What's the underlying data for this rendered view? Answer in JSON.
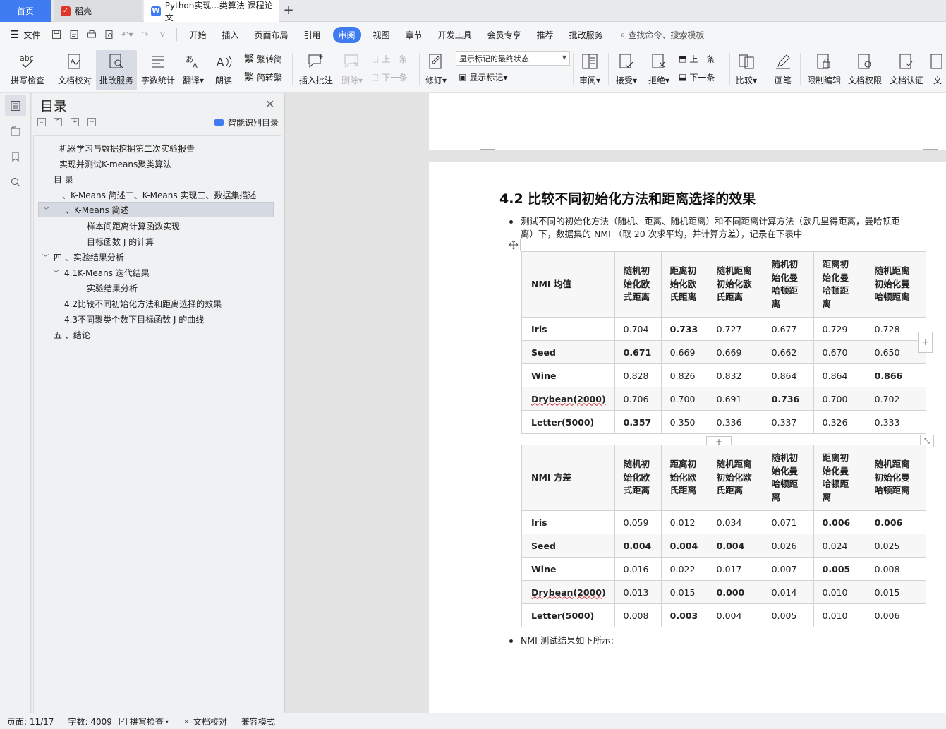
{
  "tabs": {
    "home": "首页",
    "daoke": "稻壳",
    "doc": "Python实现...类算法 课程论文",
    "new_tab": "+"
  },
  "menu": {
    "file": "文件",
    "items": [
      "开始",
      "插入",
      "页面布局",
      "引用",
      "审阅",
      "视图",
      "章节",
      "开发工具",
      "会员专享",
      "推荐",
      "批改服务"
    ],
    "active": "审阅",
    "search": "查找命令、搜索模板"
  },
  "ribbon": {
    "spell": "拼写检查",
    "doccheck": "文档校对",
    "pigai": "批改服务",
    "wordcount": "字数统计",
    "translate": "翻译",
    "read": "朗读",
    "trad_to_simp": "繁转简",
    "simp_to_trad": "简转繁",
    "insert_comment": "插入批注",
    "delete": "删除",
    "prev": "上一条",
    "next": "下一条",
    "revise": "修订",
    "markup_state": "显示标记的最终状态",
    "show_markup": "显示标记",
    "review": "审阅",
    "accept": "接受",
    "reject": "拒绝",
    "prev2": "上一条",
    "next2": "下一条",
    "compare": "比较",
    "pen": "画笔",
    "restrict": "限制编辑",
    "perm": "文档权限",
    "cert": "文档认证",
    "more": "文"
  },
  "toc": {
    "title": "目录",
    "smart": "智能识别目录",
    "items": [
      "机器学习与数据挖掘第二次实验报告",
      "实现并测试K-means聚类算法",
      "目 录",
      "一、K-Means 简述二、K-Means 实现三、数据集描述",
      "一 、K-Means 简述",
      "样本间距离计算函数实现",
      "目标函数 J 的计算",
      "四 、实验结果分析",
      "4.1K-Means 迭代结果",
      "实验结果分析",
      "4.2比较不同初始化方法和距离选择的效果",
      "4.3不同聚类个数下目标函数 J 的曲线",
      "五 、结论"
    ]
  },
  "doc": {
    "heading": "4.2 比较不同初始化方法和距离选择的效果",
    "bullet1_line1": "测试不同的初始化方法（随机、距离、随机距离）和不同距离计算方法（欧几里得距离，曼哈顿距",
    "bullet1_line2": "离）下，数据集的 NMI （取 20 次求平均，并计算方差），记录在下表中",
    "bullet2": "NMI 测试结果如下所示:",
    "mean_table": {
      "corner": "NMI 均值",
      "headers": [
        "随机初始化欧式距离",
        "距离初始化欧氏距离",
        "随机距离初始化欧氏距离",
        "随机初始化曼哈顿距离",
        "距离初始化曼哈顿距离",
        "随机距离初始化曼哈顿距离"
      ],
      "rows": [
        {
          "name": "Iris",
          "values": [
            "0.704",
            "0.733",
            "0.727",
            "0.677",
            "0.729",
            "0.728"
          ]
        },
        {
          "name": "Seed",
          "values": [
            "0.671",
            "0.669",
            "0.669",
            "0.662",
            "0.670",
            "0.650"
          ]
        },
        {
          "name": "Wine",
          "values": [
            "0.828",
            "0.826",
            "0.832",
            "0.864",
            "0.864",
            "0.866"
          ]
        },
        {
          "name": "Drybean(2000)",
          "values": [
            "0.706",
            "0.700",
            "0.691",
            "0.736",
            "0.700",
            "0.702"
          ]
        },
        {
          "name": "Letter(5000)",
          "values": [
            "0.357",
            "0.350",
            "0.336",
            "0.337",
            "0.326",
            "0.333"
          ]
        }
      ]
    },
    "var_table": {
      "corner": "NMI 方差",
      "headers": [
        "随机初始化欧式距离",
        "距离初始化欧氏距离",
        "随机距离初始化欧氏距离",
        "随机初始化曼哈顿距离",
        "距离初始化曼哈顿距离",
        "随机距离初始化曼哈顿距离"
      ],
      "rows": [
        {
          "name": "Iris",
          "values": [
            "0.059",
            "0.012",
            "0.034",
            "0.071",
            "0.006",
            "0.006"
          ]
        },
        {
          "name": "Seed",
          "values": [
            "0.004",
            "0.004",
            "0.004",
            "0.026",
            "0.024",
            "0.025"
          ]
        },
        {
          "name": "Wine",
          "values": [
            "0.016",
            "0.022",
            "0.017",
            "0.007",
            "0.005",
            "0.008"
          ]
        },
        {
          "name": "Drybean(2000)",
          "values": [
            "0.013",
            "0.015",
            "0.000",
            "0.014",
            "0.010",
            "0.015"
          ]
        },
        {
          "name": "Letter(5000)",
          "values": [
            "0.008",
            "0.003",
            "0.004",
            "0.005",
            "0.010",
            "0.006"
          ]
        }
      ]
    }
  },
  "status": {
    "page": "页面: 11/17",
    "words": "字数: 4009",
    "spell": "拼写检查",
    "doccheck": "文档校对",
    "compat": "兼容模式"
  },
  "colors": {
    "accent": "#3f7cf2",
    "daoke_red": "#e0352b"
  }
}
